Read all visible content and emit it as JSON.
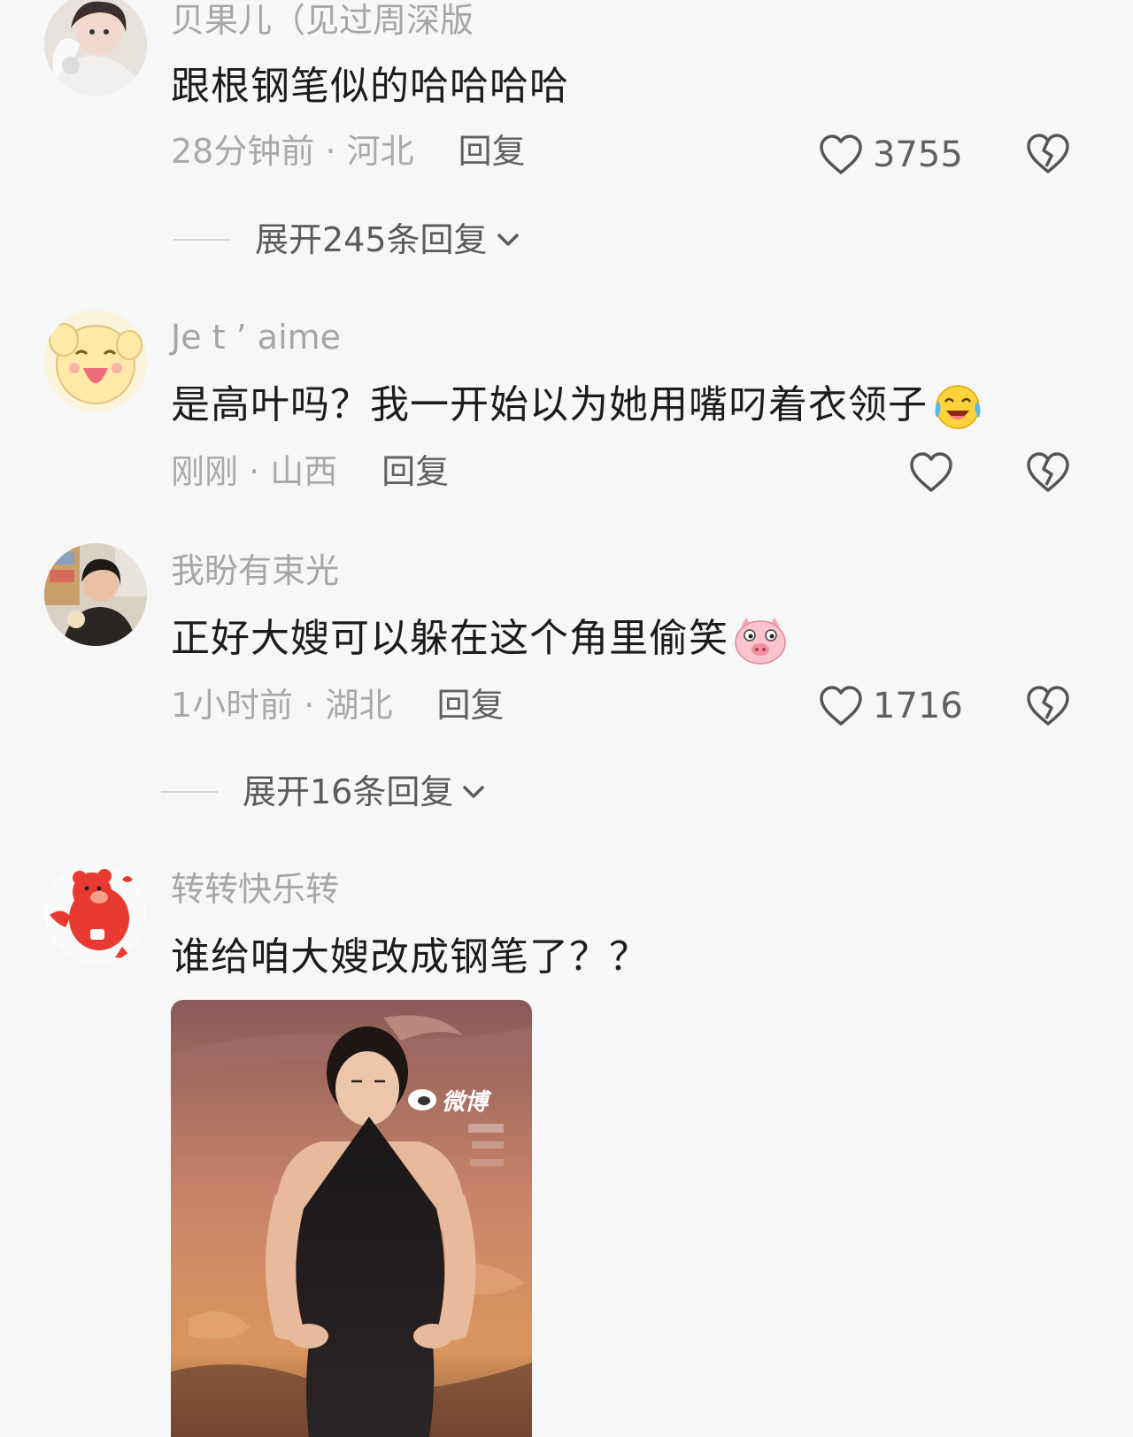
{
  "comments": [
    {
      "username": "贝果儿（见过周深版",
      "text": "跟根钢笔似的哈哈哈哈",
      "time": "28分钟前",
      "location": "河北",
      "reply_label": "回复",
      "likes": "3755",
      "expand_label": "展开245条回复"
    },
    {
      "username": "Je t ’ aime",
      "text": "是高叶吗？我一开始以为她用嘴叼着衣领子",
      "emoji": "crying-laughing-emoji",
      "time": "刚刚",
      "location": "山西",
      "reply_label": "回复",
      "likes": ""
    },
    {
      "username": "我盼有束光",
      "text": "正好大嫂可以躲在这个角里偷笑",
      "emoji": "pig-face-emoji",
      "time": "1小时前",
      "location": "湖北",
      "reply_label": "回复",
      "likes": "1716",
      "expand_label": "展开16条回复"
    },
    {
      "username": "转转快乐转",
      "text": "谁给咱大嫂改成钢笔了？？",
      "image_watermark": "微博"
    }
  ],
  "separator": " · ",
  "colors": {
    "background": "#f7f7f7",
    "username": "#a6a6a6",
    "text": "#1c1c1c",
    "meta": "#a9a9a9",
    "reply": "#606060",
    "icon": "#555555"
  },
  "icons": [
    "heart-icon",
    "broken-heart-icon",
    "chevron-down-icon"
  ]
}
